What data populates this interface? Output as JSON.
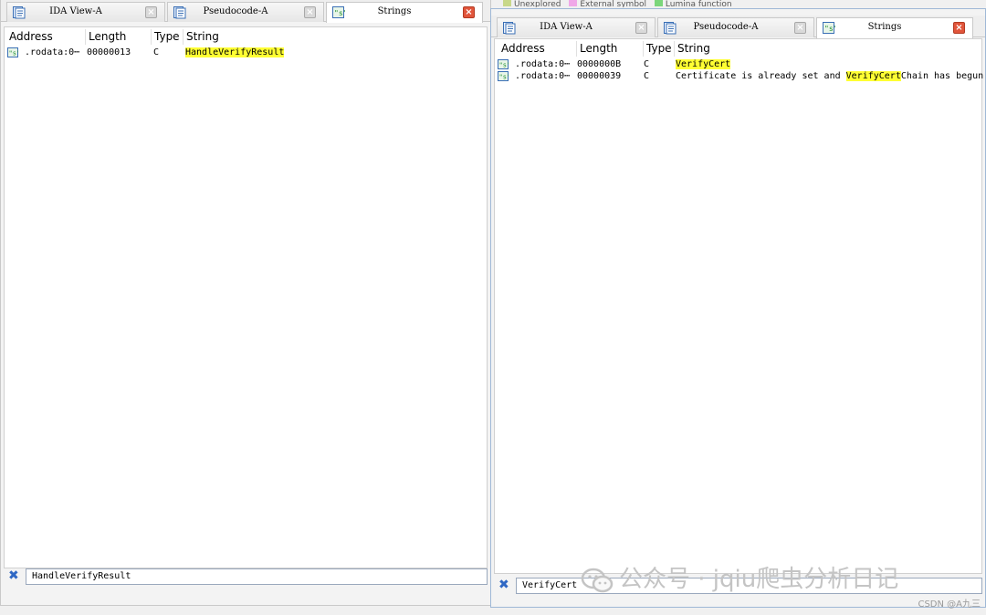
{
  "legend": {
    "items": [
      {
        "label": "Unexplored",
        "color": "#c8d88a"
      },
      {
        "label": "External symbol",
        "color": "#f0a8e8"
      },
      {
        "label": "Lumina function",
        "color": "#7bd67b"
      }
    ]
  },
  "left": {
    "tabs": [
      {
        "label": "IDA View-A"
      },
      {
        "label": "Pseudocode-A"
      },
      {
        "label": "Strings"
      }
    ],
    "columns": [
      "Address",
      "Length",
      "Type",
      "String"
    ],
    "rows": [
      {
        "address": ".rodata:0⋯",
        "length": "00000013",
        "type": "C",
        "hl": "HandleVerifyResult",
        "after": ""
      }
    ],
    "filter": "HandleVerifyResult"
  },
  "right": {
    "tabs": [
      {
        "label": "IDA View-A"
      },
      {
        "label": "Pseudocode-A"
      },
      {
        "label": "Strings"
      }
    ],
    "columns": [
      "Address",
      "Length",
      "Type",
      "String"
    ],
    "rows": [
      {
        "address": ".rodata:0⋯",
        "length": "0000000B",
        "type": "C",
        "before": "",
        "hl": "VerifyCert",
        "after": ""
      },
      {
        "address": ".rodata:0⋯",
        "length": "00000039",
        "type": "C",
        "before": "Certificate is already set and ",
        "hl": "VerifyCert",
        "after": "Chain has begun"
      }
    ],
    "filter": "VerifyCert"
  },
  "watermark": "公众号 · jqiu爬虫分析日记",
  "credit": "CSDN @A九三"
}
